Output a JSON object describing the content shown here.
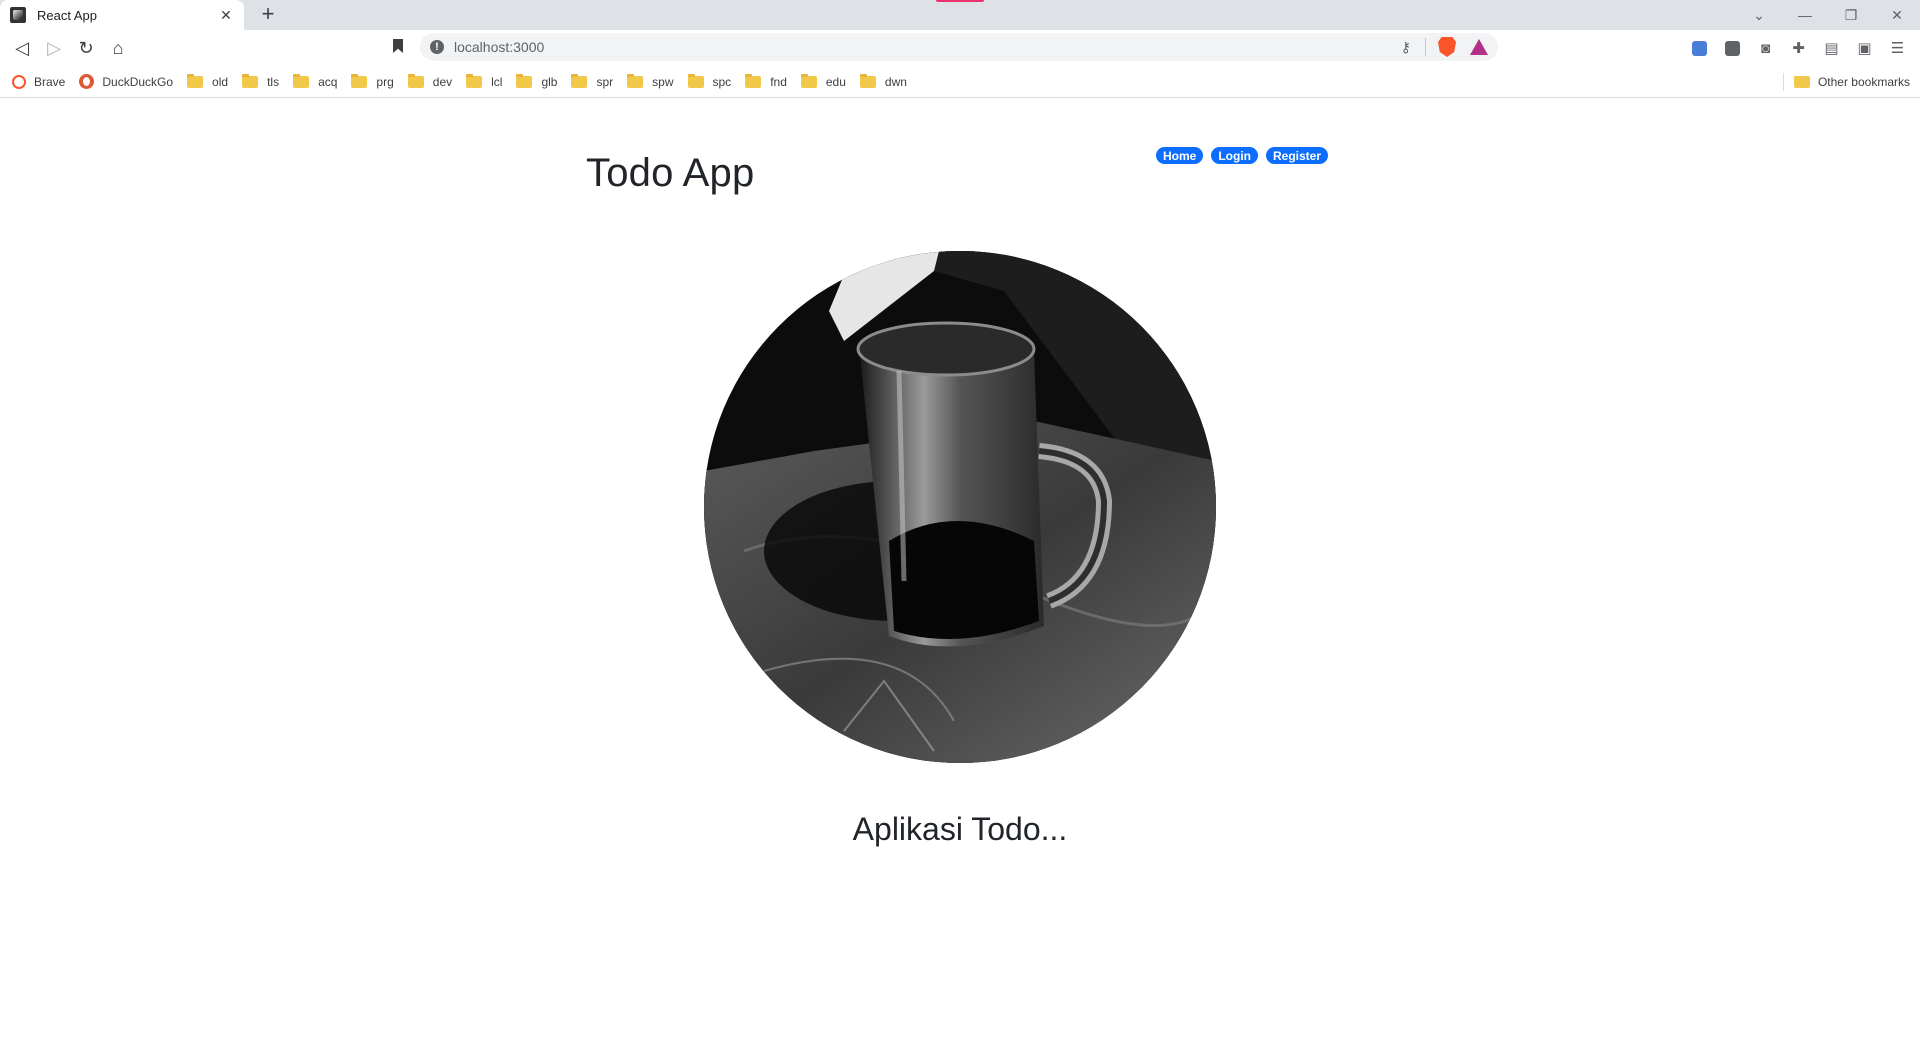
{
  "browser": {
    "tab_title": "React App",
    "url": "localhost:3000",
    "bookmarks": [
      "Brave",
      "DuckDuckGo",
      "old",
      "tls",
      "acq",
      "prg",
      "dev",
      "lcl",
      "glb",
      "spr",
      "spw",
      "spc",
      "fnd",
      "edu",
      "dwn"
    ],
    "other_bookmarks": "Other bookmarks"
  },
  "app": {
    "title": "Todo App",
    "nav": [
      "Home",
      "Login",
      "Register"
    ],
    "subtitle": "Aplikasi Todo...",
    "accent_color": "#0d6efd",
    "hero_image": "grayscale-mug-photo"
  }
}
